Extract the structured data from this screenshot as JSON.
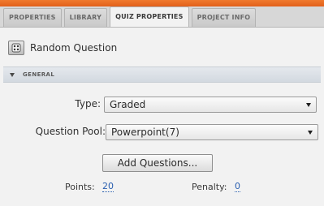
{
  "tabs": [
    {
      "label": "PROPERTIES"
    },
    {
      "label": "LIBRARY"
    },
    {
      "label": "QUIZ PROPERTIES",
      "active": true
    },
    {
      "label": "PROJECT INFO"
    }
  ],
  "header": {
    "title": "Random Question",
    "icon": "random-question-icon"
  },
  "section": {
    "title": "GENERAL",
    "expanded": true
  },
  "type_field": {
    "label": "Type:",
    "value": "Graded"
  },
  "pool_field": {
    "label": "Question Pool:",
    "value": "Powerpoint(7)"
  },
  "add_button": {
    "label": "Add Questions..."
  },
  "points": {
    "label": "Points:",
    "value": "20"
  },
  "penalty": {
    "label": "Penalty:",
    "value": "0"
  },
  "colors": {
    "accent_bar": "#e86a24",
    "link_value": "#2a5fb0",
    "section_bg": "#dde2e8"
  }
}
